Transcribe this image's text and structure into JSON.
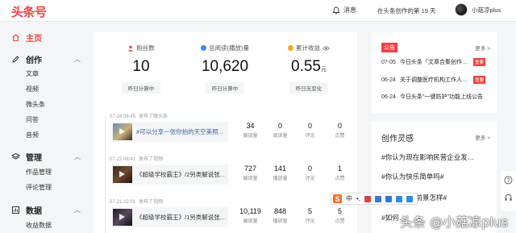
{
  "header": {
    "logo": "头条号",
    "messages_label": "消息",
    "days_text": "在头条创作的第 19 天",
    "username": "小菇凉plus"
  },
  "sidebar": {
    "home": "主页",
    "sections": [
      {
        "label": "创作",
        "items": [
          "文章",
          "视频",
          "微头条",
          "问答",
          "音频"
        ]
      },
      {
        "label": "管理",
        "items": [
          "作品管理",
          "评论管理"
        ]
      },
      {
        "label": "数据",
        "items": [
          "收益数据"
        ]
      }
    ]
  },
  "stats": [
    {
      "label": "粉丝数",
      "value": "10",
      "unit": "",
      "note": "昨日计算中"
    },
    {
      "label": "总阅读(播放)量",
      "value": "10,620",
      "unit": "",
      "note": "昨日计算中"
    },
    {
      "label": "累计收益",
      "value": "0.55",
      "unit": "元",
      "note": "昨日无变化"
    }
  ],
  "posts": [
    {
      "time": "07-24 08:45",
      "action": "发布了微头条",
      "title": "#可以分享一张你拍的天空美照...",
      "is_link": true,
      "metrics": [
        {
          "value": "34",
          "label": "展现量"
        },
        {
          "value": "0",
          "label": "阅读量"
        },
        {
          "value": "0",
          "label": "评论"
        },
        {
          "value": "0",
          "label": "点赞"
        }
      ]
    },
    {
      "time": "07-22 08:41",
      "action": "发布了视频",
      "title": "《超级学校霸王》/2另类解说张...",
      "is_link": false,
      "metrics": [
        {
          "value": "727",
          "label": "展现量"
        },
        {
          "value": "141",
          "label": "播放量"
        },
        {
          "value": "0",
          "label": "评论"
        },
        {
          "value": "1",
          "label": "点赞"
        }
      ]
    },
    {
      "time": "07-21 22:01",
      "action": "发布了视频",
      "title": "《超级学校霸王》/1另类解说张...",
      "is_link": false,
      "metrics": [
        {
          "value": "10,119",
          "label": "展现量"
        },
        {
          "value": "848",
          "label": "播放量"
        },
        {
          "value": "5",
          "label": "评论"
        },
        {
          "value": "5",
          "label": "点赞"
        }
      ]
    }
  ],
  "announcements": {
    "tag": "公告",
    "more": "更多 >",
    "items": [
      {
        "date": "07-05",
        "title": "今日头条「文章合集创作…",
        "badge": "重要"
      },
      {
        "date": "06-24",
        "title": "关于调整医疗机构工作人…",
        "badge": "重要"
      },
      {
        "date": "06-24",
        "title": "今日头条\"一键防护\"功能上线公告",
        "badge": ""
      }
    ]
  },
  "inspiration": {
    "title": "创作灵感",
    "more": "更多 >",
    "items": [
      "#你认为现在影响民营企业发…",
      "#你认为快乐简单吗#",
      "…市行业，前景怎样#",
      "#如何…"
    ]
  },
  "watermark": "头条 @小菇凉plus",
  "colors": {
    "brand": "#f04142",
    "link": "#406599",
    "bg": "#f4f5f6"
  }
}
